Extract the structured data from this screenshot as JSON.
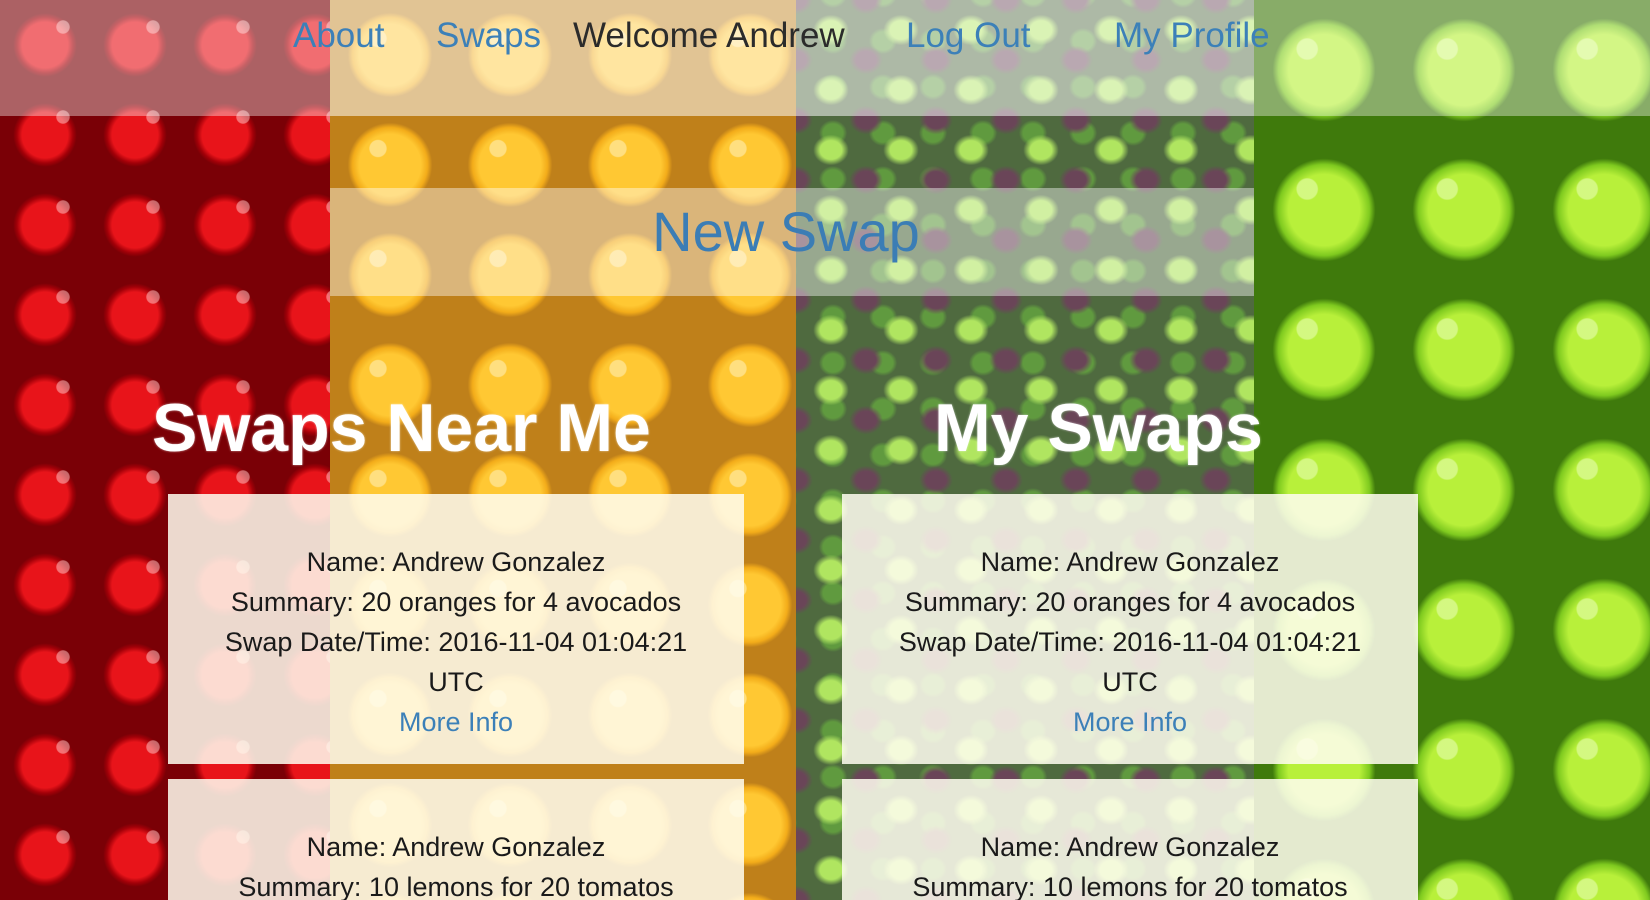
{
  "nav": {
    "about": "About",
    "swaps": "Swaps",
    "welcome": "Welcome Andrew",
    "logout": "Log Out",
    "profile": "My Profile"
  },
  "new_swap_link": "New Swap",
  "sections": {
    "near_me": {
      "title": "Swaps Near Me",
      "cards": [
        {
          "name": "Name: Andrew Gonzalez",
          "summary": "Summary: 20 oranges for 4 avocados",
          "datetime": "Swap Date/Time: 2016-11-04 01:04:21",
          "tz": "UTC",
          "more": "More Info"
        },
        {
          "name": "Name: Andrew Gonzalez",
          "summary": "Summary: 10 lemons for 20 tomatos"
        }
      ]
    },
    "mine": {
      "title": "My Swaps",
      "cards": [
        {
          "name": "Name: Andrew Gonzalez",
          "summary": "Summary: 20 oranges for 4 avocados",
          "datetime": "Swap Date/Time: 2016-11-04 01:04:21",
          "tz": "UTC",
          "more": "More Info"
        },
        {
          "name": "Name: Andrew Gonzalez",
          "summary": "Summary: 10 lemons for 20 tomatos"
        }
      ]
    }
  },
  "colors": {
    "link": "#3c80b8",
    "title": "#ffffff",
    "card_bg": "#fffdf0"
  },
  "background_panels": [
    "tomatoes",
    "oranges",
    "kale",
    "limes"
  ]
}
